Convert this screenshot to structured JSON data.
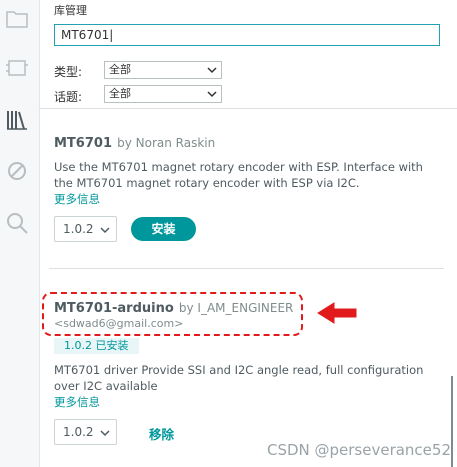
{
  "panel": {
    "title": "库管理",
    "search_value": "MT6701",
    "filters": [
      {
        "label": "类型:",
        "value": "全部"
      },
      {
        "label": "话题:",
        "value": "全部"
      }
    ]
  },
  "activity": {
    "icons": [
      "folder-icon",
      "board-icon",
      "library-icon",
      "debug-icon",
      "search-icon"
    ]
  },
  "libraries": [
    {
      "name": "MT6701",
      "author": "by Noran Raskin",
      "description": "Use the MT6701 magnet rotary encoder with ESP. Interface with the MT6701 magnet rotary encoder with ESP via I2C.",
      "more_info": "更多信息",
      "version": "1.0.2",
      "action": "安装"
    },
    {
      "name": "MT6701-arduino",
      "author": "by I_AM_ENGINEER",
      "email": "<sdwad6@gmail.com>",
      "installed": "1.0.2 已安装",
      "description": "MT6701 driver Provide SSI and I2C angle read, full configuration over I2C available",
      "more_info": "更多信息",
      "version": "1.0.2",
      "action": "移除"
    }
  ],
  "watermark": "CSDN @perseverance52",
  "colors": {
    "accent": "#00979c",
    "highlight": "#e11b1b"
  }
}
